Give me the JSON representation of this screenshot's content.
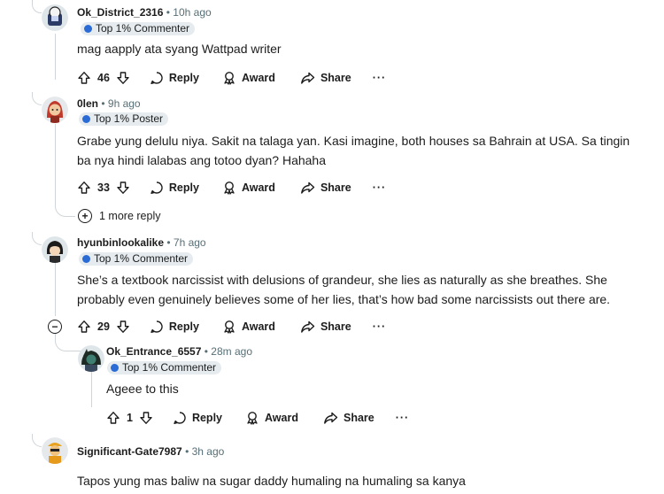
{
  "comments": [
    {
      "username": "Ok_District_2316",
      "time": "10h ago",
      "badge": "Top 1% Commenter",
      "text": "mag aapply ata syang Wattpad writer",
      "votes": "46",
      "actions": {
        "reply": "Reply",
        "award": "Award",
        "share": "Share",
        "more": "···"
      }
    },
    {
      "username": "0len",
      "time": "9h ago",
      "badge": "Top 1% Poster",
      "text_line1": "Grabe yung delulu niya. Sakit na talaga yan. Kasi imagine, both houses sa Bahrain at USA. Sa tingin",
      "text_line2": "ba nya hindi lalabas ang totoo dyan? Hahaha",
      "votes": "33",
      "actions": {
        "reply": "Reply",
        "award": "Award",
        "share": "Share",
        "more": "···"
      },
      "more_replies": "1 more reply"
    },
    {
      "username": "hyunbinlookalike",
      "time": "7h ago",
      "badge": "Top 1% Commenter",
      "text_line1": "She’s a textbook narcissist with delusions of grandeur, she lies as naturally as she breathes. She",
      "text_line2": "probably even genuinely believes some of her lies, that’s how bad some narcissists out there are.",
      "votes": "29",
      "actions": {
        "reply": "Reply",
        "award": "Award",
        "share": "Share",
        "more": "···"
      }
    },
    {
      "username": "Ok_Entrance_6557",
      "time": "28m ago",
      "badge": "Top 1% Commenter",
      "text": "Ageee to this",
      "votes": "1",
      "actions": {
        "reply": "Reply",
        "award": "Award",
        "share": "Share",
        "more": "···"
      }
    },
    {
      "username": "Significant-Gate7987",
      "time": "3h ago",
      "text": "Tapos yung mas baliw na sugar daddy humaling na humaling sa kanya"
    }
  ],
  "separator": "•",
  "colors": {
    "meta": "#576f76",
    "badge_bg": "#e5ebee",
    "thread_line": "#d0d5d9",
    "commenter_badge_icon": "#2a6bd6",
    "poster_badge_icon": "#2a6bd6"
  },
  "icons": [
    "upvote-icon",
    "downvote-icon",
    "reply-bubble-icon",
    "award-icon",
    "share-icon",
    "more-icon",
    "plus-circle-icon",
    "collapse-icon",
    "badge-icon"
  ]
}
